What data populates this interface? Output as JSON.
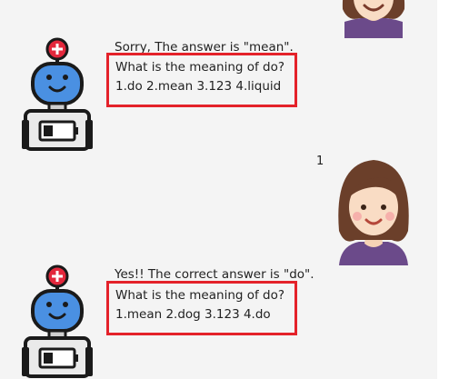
{
  "messages": [
    {
      "sender": "bot",
      "feedback": "Sorry, The answer is \"mean\".",
      "question": "What is the meaning of do?",
      "options": "1.do  2.mean  3.123  4.liquid"
    },
    {
      "sender": "user",
      "text": "1"
    },
    {
      "sender": "bot",
      "feedback": "Yes!! The correct answer is \"do\".",
      "question": "What is the meaning of do?",
      "options": "1.mean  2.dog  3.123  4.do"
    }
  ],
  "colors": {
    "highlight_border": "#e4222a",
    "robot_head": "#4a90e2",
    "robot_badge": "#e3283c",
    "user_shirt": "#6b4a8a",
    "user_hair": "#6b3f2a",
    "background": "#f4f4f4"
  },
  "icons": {
    "bot": "robot-avatar-icon",
    "user": "woman-avatar-icon"
  }
}
